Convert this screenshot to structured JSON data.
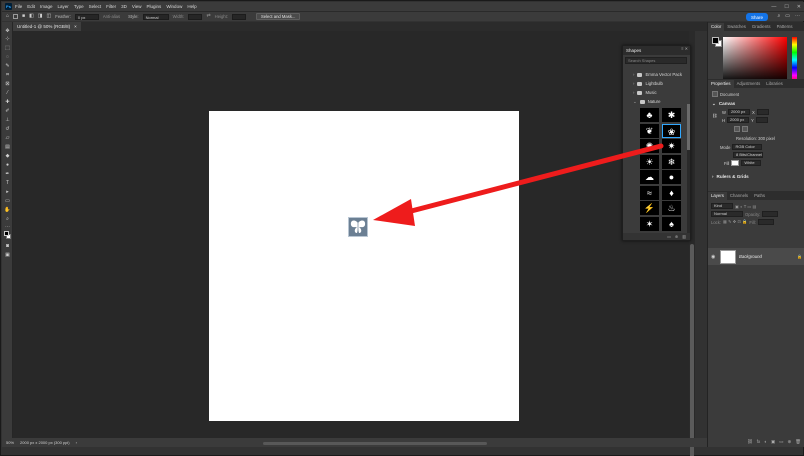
{
  "menu": {
    "app_icon": "Ps",
    "items": [
      "File",
      "Edit",
      "Image",
      "Layer",
      "Type",
      "Select",
      "Filter",
      "3D",
      "View",
      "Plugins",
      "Window",
      "Help"
    ],
    "window_controls": [
      "—",
      "☐",
      "✕"
    ]
  },
  "options_bar": {
    "feather_label": "Feather:",
    "feather_value": "0 px",
    "antialias_label": "Anti-alias",
    "style_label": "Style:",
    "style_value": "Normal",
    "width_label": "Width:",
    "height_label": "Height:",
    "select_mask_label": "Select and Mask...",
    "share_label": "Share"
  },
  "document_tab": {
    "title": "Untitled-1 @ 50% (RGB/8)",
    "close": "×"
  },
  "status_bar": {
    "zoom": "50%",
    "doc_info": "2000 px x 2000 px (300 ppi)",
    "arrow": "›"
  },
  "shapes_panel": {
    "title": "Shapes",
    "search_placeholder": "Search Shapes",
    "folders": [
      "Emma Vector Pack",
      "Lightbulb",
      "Music",
      "Nature"
    ],
    "shape_icons": [
      "tree-icon",
      "grass-icon",
      "leaf-icon",
      "butterfly-icon",
      "burst-icon",
      "starburst-icon",
      "sun-icon",
      "snowflake-icon",
      "cloud-icon",
      "raindrop-icon",
      "waves-icon",
      "flame-icon",
      "lightning-icon",
      "fire-icon",
      "splash-icon",
      "tree2-icon"
    ],
    "shape_glyphs": [
      "♣",
      "✱",
      "❦",
      "❀",
      "✺",
      "✷",
      "☀",
      "❄",
      "☁",
      "●",
      "≈",
      "♦",
      "⚡",
      "♨",
      "✶",
      "♠"
    ],
    "selected_index": 3
  },
  "right_dock": {
    "color_tabs": [
      "Color",
      "Swatches",
      "Gradients",
      "Patterns"
    ],
    "properties_tabs": [
      "Properties",
      "Adjustments",
      "Libraries"
    ],
    "properties_subtitle": "Document",
    "canvas_section": "Canvas",
    "width_value": "2000 px",
    "height_value": "2000 px",
    "x_label": "X",
    "y_label": "Y",
    "resolution": "Resolution: 300 pixel",
    "mode_label": "Mode",
    "mode_value": "RGB Color",
    "bits_value": "8 Bits/Channel",
    "fill_label": "Fill",
    "fill_value": "White",
    "rulers_section": "Rulers & Grids",
    "layers_tabs": [
      "Layers",
      "Channels",
      "Paths"
    ],
    "kind_label": "Kind",
    "blend_mode": "Normal",
    "opacity_label": "Opacity:",
    "lock_label": "Lock:",
    "fill_pct_label": "Fill:",
    "layer_name": "Background",
    "footer_icons": [
      "fx",
      "◐",
      "▣",
      "▭",
      "⊕",
      "🗑"
    ]
  },
  "colors": {
    "arrow": "#ee1c1c",
    "accent": "#1473e6"
  }
}
